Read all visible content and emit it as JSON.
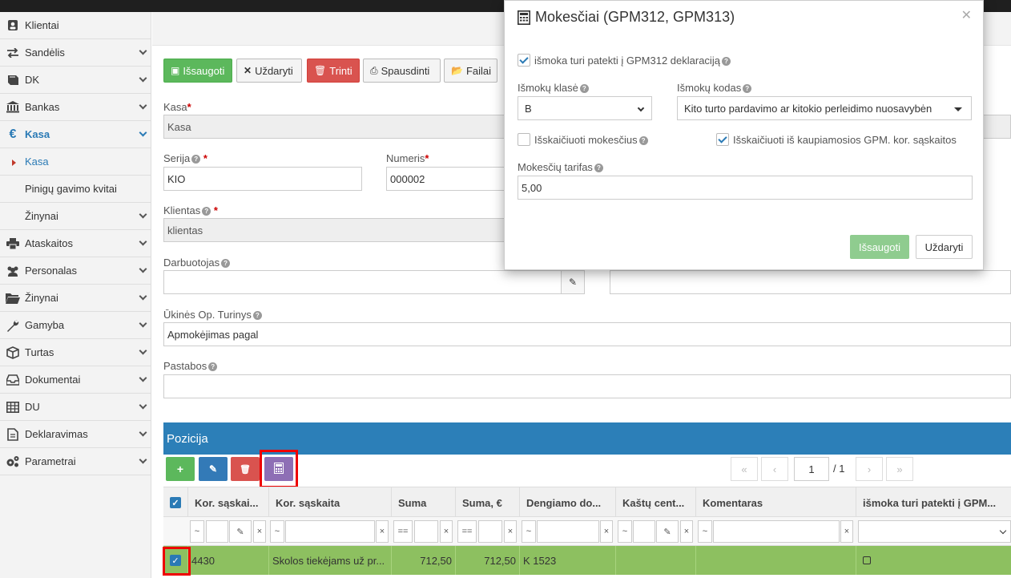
{
  "sidebar": {
    "items": [
      {
        "label": "Klientai",
        "icon": "person-icon"
      },
      {
        "label": "Sandėlis",
        "icon": "exchange-icon"
      },
      {
        "label": "DK",
        "icon": "book-icon"
      },
      {
        "label": "Bankas",
        "icon": "bank-icon"
      },
      {
        "label": "Kasa",
        "icon": "euro-icon"
      },
      {
        "label": "Kasa"
      },
      {
        "label": "Pinigų gavimo kvitai"
      },
      {
        "label": "Žinynai"
      },
      {
        "label": "Ataskaitos",
        "icon": "print-icon"
      },
      {
        "label": "Personalas",
        "icon": "users-icon"
      },
      {
        "label": "Žinynai",
        "icon": "folder-icon"
      },
      {
        "label": "Gamyba",
        "icon": "wrench-icon"
      },
      {
        "label": "Turtas",
        "icon": "cube-icon"
      },
      {
        "label": "Dokumentai",
        "icon": "inbox-icon"
      },
      {
        "label": "DU",
        "icon": "table-icon"
      },
      {
        "label": "Deklaravimas",
        "icon": "document-icon"
      },
      {
        "label": "Parametrai",
        "icon": "gears-icon"
      }
    ]
  },
  "toolbar": {
    "save": "Išsaugoti",
    "close": "Uždaryti",
    "delete": "Trinti",
    "print": "Spausdinti",
    "files": "Failai"
  },
  "form": {
    "kasa_label": "Kasa",
    "kasa_value": "Kasa",
    "serija_label": "Serija",
    "serija_value": "KIO",
    "numeris_label": "Numeris",
    "numeris_value": "000002",
    "klientas_label": "Klientas",
    "klientas_value": "klientas",
    "darbuotojas_label": "Darbuotojas",
    "ukines_label": "Ūkinės Op. Turinys",
    "ukines_value": "Apmokėjimas pagal",
    "pastabos_label": "Pastabos"
  },
  "pozicija": {
    "title": "Pozicija",
    "page": "1",
    "page_total": "/ 1",
    "columns": [
      "Kor. sąskai...",
      "Kor. sąskaita",
      "Suma",
      "Suma, €",
      "Dengiamo do...",
      "Kaštų cent...",
      "Komentaras",
      "išmoka turi patekti į GPM..."
    ],
    "filter_ops": [
      "~",
      "~",
      "==",
      "==",
      "~",
      "~",
      "~"
    ],
    "row": {
      "kor_saskaita_code": "4430",
      "kor_saskaita": "Skolos tiekėjams už pr...",
      "suma": "712,50",
      "suma_eur": "712,50",
      "dengiamo": "K 1523"
    }
  },
  "modal": {
    "title": "Mokesčiai (GPM312, GPM313)",
    "gpm_checkbox_label": "išmoka turi patekti į GPM312 deklaraciją",
    "gpm_checked": true,
    "klase_label": "Išmokų klasė",
    "klase_value": "B",
    "kodas_label": "Išmokų kodas",
    "kodas_value": "Kito turto pardavimo ar kitokio perleidimo nuosavybėn",
    "isskaiciuoti_label": "Išskaičiuoti mokesčius",
    "isskaiciuoti_checked": false,
    "kaupiamosios_label": "Išskaičiuoti iš kaupiamosios GPM. kor. sąskaitos",
    "kaupiamosios_checked": true,
    "tarifas_label": "Mokesčių tarifas",
    "tarifas_value": "5,00",
    "save": "Išsaugoti",
    "close": "Uždaryti"
  },
  "colors": {
    "accent": "#2a7ab5",
    "pozicija_header": "#2c7fb8",
    "selected_row": "#8dc060",
    "save_green": "#5cb85c",
    "delete_red": "#d9534f",
    "calc_purple": "#8e6fb5",
    "highlight_red": "#e00000"
  }
}
